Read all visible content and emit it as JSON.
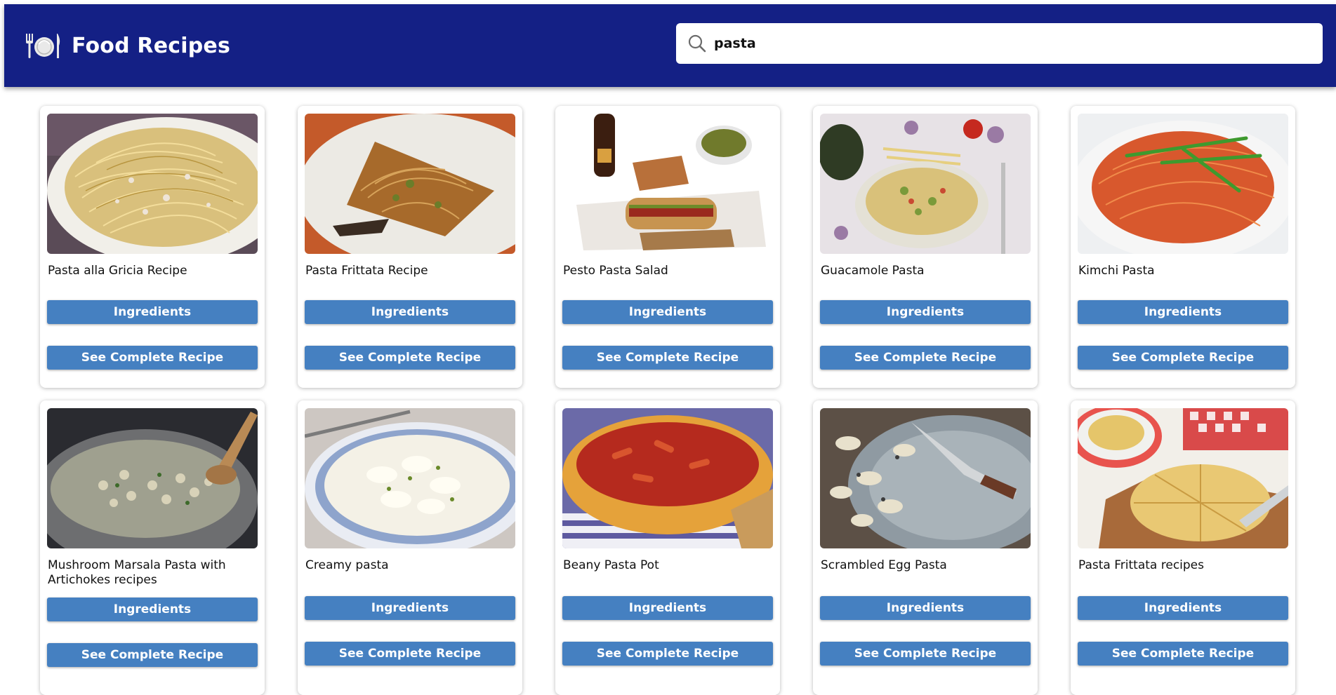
{
  "header": {
    "title": "Food Recipes",
    "logo_icon": "fork-plate-knife-icon",
    "background": "#142085"
  },
  "search": {
    "value": "pasta",
    "icon": "search-icon"
  },
  "buttons": {
    "ingredients_label": "Ingredients",
    "complete_label": "See Complete Recipe",
    "color": "#4580c1"
  },
  "recipes": [
    {
      "title": "Pasta alla Gricia Recipe",
      "image": "spaghetti with pecorino and guanciale on plate"
    },
    {
      "title": "Pasta Frittata Recipe",
      "image": "slice of spaghetti frittata"
    },
    {
      "title": "Pesto Pasta Salad",
      "image": "sandwich, bottle and snacks on paper"
    },
    {
      "title": "Guacamole Pasta",
      "image": "bowl of penne with vegetables"
    },
    {
      "title": "Kimchi Pasta",
      "image": "spaghetti in red sauce with scallions"
    },
    {
      "title": "Mushroom Marsala Pasta with Artichokes recipes",
      "image": "pan of orecchiette with mushrooms"
    },
    {
      "title": "Creamy pasta",
      "image": "plate of creamy macaroni with parsley"
    },
    {
      "title": "Beany Pasta Pot",
      "image": "bowl of penne in tomato sauce"
    },
    {
      "title": "Scrambled Egg Pasta",
      "image": "plate of pasta with egg and fork"
    },
    {
      "title": "Pasta Frittata recipes",
      "image": "sliced frittata on board"
    }
  ]
}
